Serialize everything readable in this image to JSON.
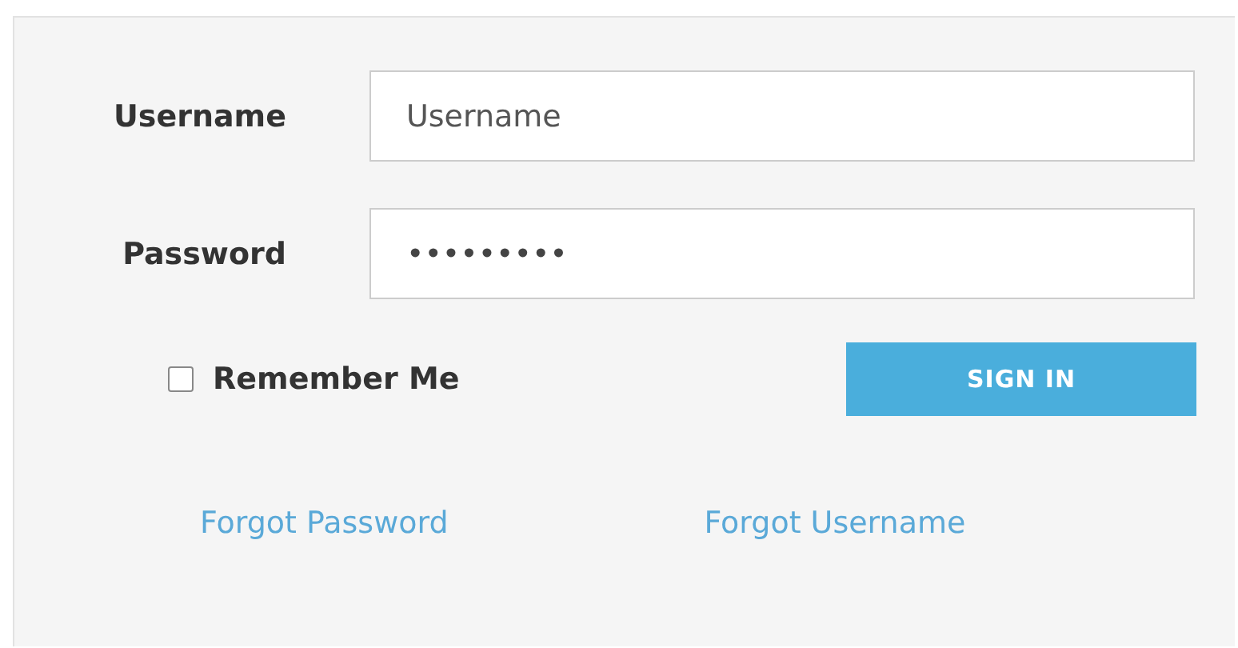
{
  "fields": [
    {
      "label": "Username",
      "placeholder": "Username"
    },
    {
      "label": "Password",
      "value": "•••••••••"
    }
  ],
  "remember": {
    "label": "Remember Me",
    "checked": false
  },
  "submit": "SIGN IN",
  "links": [
    "Forgot Password",
    "Forgot Username"
  ]
}
